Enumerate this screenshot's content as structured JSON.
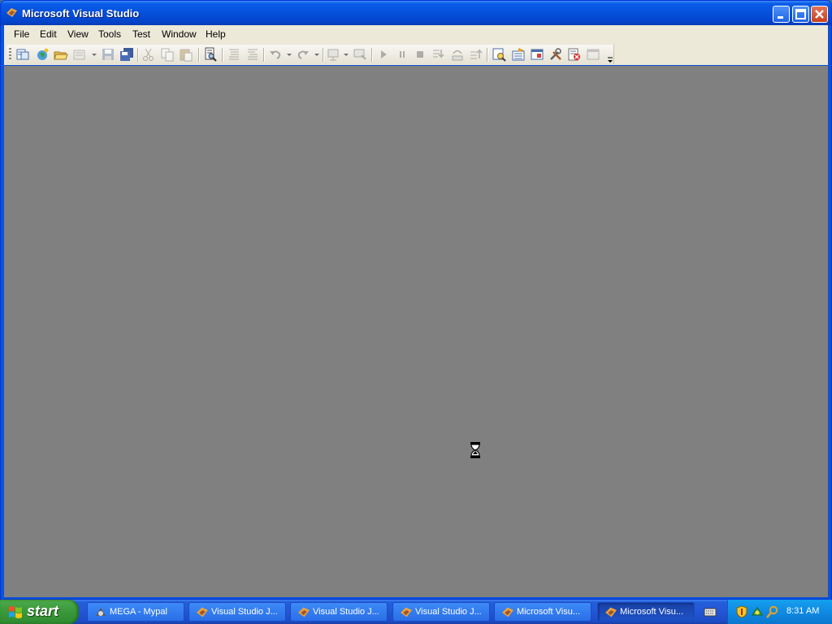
{
  "window": {
    "title": "Microsoft Visual Studio",
    "controls": [
      "minimize-icon",
      "maximize-icon",
      "close-icon"
    ]
  },
  "menubar": {
    "items": [
      {
        "label": "File"
      },
      {
        "label": "Edit"
      },
      {
        "label": "View"
      },
      {
        "label": "Tools"
      },
      {
        "label": "Test"
      },
      {
        "label": "Window"
      },
      {
        "label": "Help"
      }
    ]
  },
  "toolbar": {
    "buttons": [
      "new-project-icon",
      "add-item-icon",
      "open-file-icon",
      "add-new-item-icon",
      "save-icon",
      "save-all-icon",
      "cut-icon",
      "copy-icon",
      "paste-icon",
      "find-icon",
      "comment-icon",
      "uncomment-icon",
      "undo-icon",
      "redo-icon",
      "navigate-backward-icon",
      "navigate-forward-icon",
      "start-icon",
      "break-all-icon",
      "stop-icon",
      "step-into-icon",
      "step-over-icon",
      "step-out-icon",
      "solution-explorer-icon",
      "properties-icon",
      "object-browser-icon",
      "toolbox-icon",
      "error-list-icon",
      "start-page-icon"
    ]
  },
  "colors": {
    "titlebar": "#0550dc",
    "menubar": "#ece9d8",
    "client_area": "#808080",
    "taskbar": "#245edb",
    "start_button": "#3c9c3c",
    "tray": "#0f8ae3"
  },
  "cursor": {
    "icon": "hourglass-icon"
  },
  "taskbar": {
    "start_label": "start",
    "tasks": [
      {
        "label": "MEGA - Mypal",
        "icon": "mypal-icon",
        "active": false
      },
      {
        "label": "Visual Studio J...",
        "icon": "visual-studio-icon",
        "active": false
      },
      {
        "label": "Visual Studio J...",
        "icon": "visual-studio-icon",
        "active": false
      },
      {
        "label": "Visual Studio J...",
        "icon": "visual-studio-icon",
        "active": false
      },
      {
        "label": "Microsoft Visu...",
        "icon": "visual-studio-icon",
        "active": false
      },
      {
        "label": "Microsoft Visu...",
        "icon": "visual-studio-icon",
        "active": true
      }
    ],
    "quick_launch": "keyboard-icon",
    "tray_icons": [
      "security-shield-icon",
      "network-icon",
      "search-icon"
    ],
    "clock": "8:31 AM"
  }
}
